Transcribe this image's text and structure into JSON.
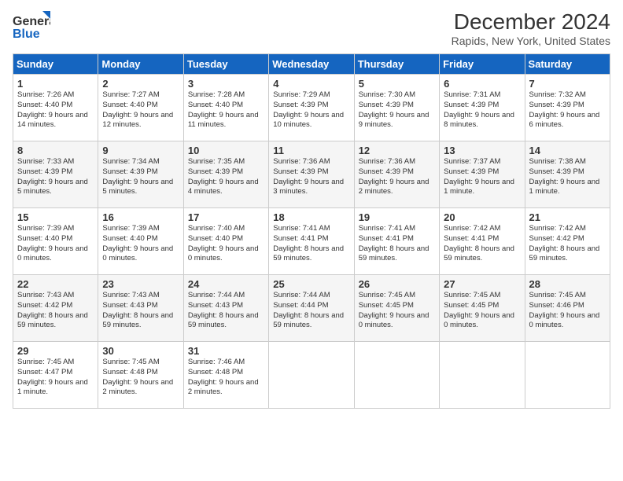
{
  "header": {
    "logo_line1": "General",
    "logo_line2": "Blue",
    "month_title": "December 2024",
    "location": "Rapids, New York, United States"
  },
  "days_of_week": [
    "Sunday",
    "Monday",
    "Tuesday",
    "Wednesday",
    "Thursday",
    "Friday",
    "Saturday"
  ],
  "weeks": [
    [
      {
        "day": "1",
        "sunrise": "7:26 AM",
        "sunset": "4:40 PM",
        "daylight": "9 hours and 14 minutes."
      },
      {
        "day": "2",
        "sunrise": "7:27 AM",
        "sunset": "4:40 PM",
        "daylight": "9 hours and 12 minutes."
      },
      {
        "day": "3",
        "sunrise": "7:28 AM",
        "sunset": "4:40 PM",
        "daylight": "9 hours and 11 minutes."
      },
      {
        "day": "4",
        "sunrise": "7:29 AM",
        "sunset": "4:39 PM",
        "daylight": "9 hours and 10 minutes."
      },
      {
        "day": "5",
        "sunrise": "7:30 AM",
        "sunset": "4:39 PM",
        "daylight": "9 hours and 9 minutes."
      },
      {
        "day": "6",
        "sunrise": "7:31 AM",
        "sunset": "4:39 PM",
        "daylight": "9 hours and 8 minutes."
      },
      {
        "day": "7",
        "sunrise": "7:32 AM",
        "sunset": "4:39 PM",
        "daylight": "9 hours and 6 minutes."
      }
    ],
    [
      {
        "day": "8",
        "sunrise": "7:33 AM",
        "sunset": "4:39 PM",
        "daylight": "9 hours and 5 minutes."
      },
      {
        "day": "9",
        "sunrise": "7:34 AM",
        "sunset": "4:39 PM",
        "daylight": "9 hours and 5 minutes."
      },
      {
        "day": "10",
        "sunrise": "7:35 AM",
        "sunset": "4:39 PM",
        "daylight": "9 hours and 4 minutes."
      },
      {
        "day": "11",
        "sunrise": "7:36 AM",
        "sunset": "4:39 PM",
        "daylight": "9 hours and 3 minutes."
      },
      {
        "day": "12",
        "sunrise": "7:36 AM",
        "sunset": "4:39 PM",
        "daylight": "9 hours and 2 minutes."
      },
      {
        "day": "13",
        "sunrise": "7:37 AM",
        "sunset": "4:39 PM",
        "daylight": "9 hours and 1 minute."
      },
      {
        "day": "14",
        "sunrise": "7:38 AM",
        "sunset": "4:39 PM",
        "daylight": "9 hours and 1 minute."
      }
    ],
    [
      {
        "day": "15",
        "sunrise": "7:39 AM",
        "sunset": "4:40 PM",
        "daylight": "9 hours and 0 minutes."
      },
      {
        "day": "16",
        "sunrise": "7:39 AM",
        "sunset": "4:40 PM",
        "daylight": "9 hours and 0 minutes."
      },
      {
        "day": "17",
        "sunrise": "7:40 AM",
        "sunset": "4:40 PM",
        "daylight": "9 hours and 0 minutes."
      },
      {
        "day": "18",
        "sunrise": "7:41 AM",
        "sunset": "4:41 PM",
        "daylight": "8 hours and 59 minutes."
      },
      {
        "day": "19",
        "sunrise": "7:41 AM",
        "sunset": "4:41 PM",
        "daylight": "8 hours and 59 minutes."
      },
      {
        "day": "20",
        "sunrise": "7:42 AM",
        "sunset": "4:41 PM",
        "daylight": "8 hours and 59 minutes."
      },
      {
        "day": "21",
        "sunrise": "7:42 AM",
        "sunset": "4:42 PM",
        "daylight": "8 hours and 59 minutes."
      }
    ],
    [
      {
        "day": "22",
        "sunrise": "7:43 AM",
        "sunset": "4:42 PM",
        "daylight": "8 hours and 59 minutes."
      },
      {
        "day": "23",
        "sunrise": "7:43 AM",
        "sunset": "4:43 PM",
        "daylight": "8 hours and 59 minutes."
      },
      {
        "day": "24",
        "sunrise": "7:44 AM",
        "sunset": "4:43 PM",
        "daylight": "8 hours and 59 minutes."
      },
      {
        "day": "25",
        "sunrise": "7:44 AM",
        "sunset": "4:44 PM",
        "daylight": "8 hours and 59 minutes."
      },
      {
        "day": "26",
        "sunrise": "7:45 AM",
        "sunset": "4:45 PM",
        "daylight": "9 hours and 0 minutes."
      },
      {
        "day": "27",
        "sunrise": "7:45 AM",
        "sunset": "4:45 PM",
        "daylight": "9 hours and 0 minutes."
      },
      {
        "day": "28",
        "sunrise": "7:45 AM",
        "sunset": "4:46 PM",
        "daylight": "9 hours and 0 minutes."
      }
    ],
    [
      {
        "day": "29",
        "sunrise": "7:45 AM",
        "sunset": "4:47 PM",
        "daylight": "9 hours and 1 minute."
      },
      {
        "day": "30",
        "sunrise": "7:45 AM",
        "sunset": "4:48 PM",
        "daylight": "9 hours and 2 minutes."
      },
      {
        "day": "31",
        "sunrise": "7:46 AM",
        "sunset": "4:48 PM",
        "daylight": "9 hours and 2 minutes."
      },
      null,
      null,
      null,
      null
    ]
  ]
}
